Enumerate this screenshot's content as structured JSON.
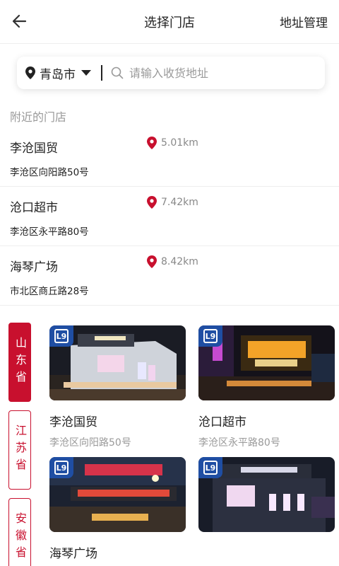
{
  "header": {
    "title": "选择门店",
    "right_action": "地址管理"
  },
  "search": {
    "city": "青岛市",
    "placeholder": "请输入收货地址"
  },
  "nearby": {
    "section_title": "附近的门店",
    "stores": [
      {
        "name": "李沧国贸",
        "distance": "5.01km",
        "address": "李沧区向阳路50号"
      },
      {
        "name": "沧口超市",
        "distance": "7.42km",
        "address": "李沧区永平路80号"
      },
      {
        "name": "海琴广场",
        "distance": "8.42km",
        "address": "市北区商丘路28号"
      }
    ]
  },
  "provinces": [
    {
      "label": "山东省",
      "active": true
    },
    {
      "label": "江苏省",
      "active": false
    },
    {
      "label": "安徽省",
      "active": false
    }
  ],
  "store_cards": [
    {
      "name": "李沧国贸",
      "address": "李沧区向阳路50号"
    },
    {
      "name": "沧口超市",
      "address": "李沧区永平路80号"
    },
    {
      "name": "海琴广场",
      "address": ""
    },
    {
      "name": "",
      "address": ""
    }
  ],
  "colors": {
    "accent": "#c8102e",
    "brand_blue": "#1f4ea3",
    "muted_text": "#999999"
  },
  "icons": {
    "back": "arrow-left-icon",
    "location": "location-pin-icon",
    "search": "search-icon",
    "caret": "caret-down-icon",
    "brand_logo": "brand-logo-icon"
  }
}
